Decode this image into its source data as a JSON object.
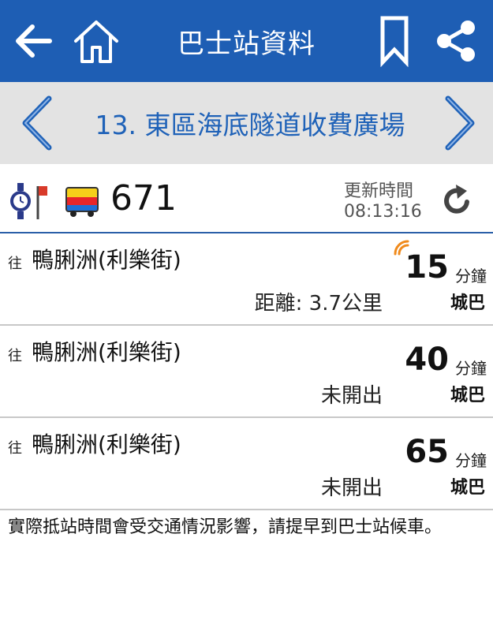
{
  "appbar": {
    "title": "巴士站資料",
    "icons": [
      "back-arrow-icon",
      "home-icon",
      "bookmark-icon",
      "share-icon"
    ]
  },
  "stop": {
    "name": "13. 東區海底隧道收費廣場",
    "icons": [
      "chevron-left-icon",
      "chevron-right-icon"
    ]
  },
  "route": {
    "number": "671",
    "update_label": "更新時間",
    "update_time": "08:13:16",
    "icons": [
      "watch-flag-icon",
      "bus-icon",
      "refresh-icon"
    ]
  },
  "etas": [
    {
      "prefix": "往",
      "destination": "鴨脷洲(利樂街)",
      "status": "距離: 3.7公里",
      "minutes": "15",
      "unit": "分鐘",
      "company": "城巴",
      "live": true
    },
    {
      "prefix": "往",
      "destination": "鴨脷洲(利樂街)",
      "status": "未開出",
      "minutes": "40",
      "unit": "分鐘",
      "company": "城巴",
      "live": false
    },
    {
      "prefix": "往",
      "destination": "鴨脷洲(利樂街)",
      "status": "未開出",
      "minutes": "65",
      "unit": "分鐘",
      "company": "城巴",
      "live": false
    }
  ],
  "notice": "實際抵站時間會受交通情況影響，請提早到巴士站候車。",
  "colors": {
    "appbar": "#1e5eb4",
    "stop_text": "#1f62b8",
    "stop_bar": "#e3e3e3",
    "live_signal": "#f08a1c"
  }
}
